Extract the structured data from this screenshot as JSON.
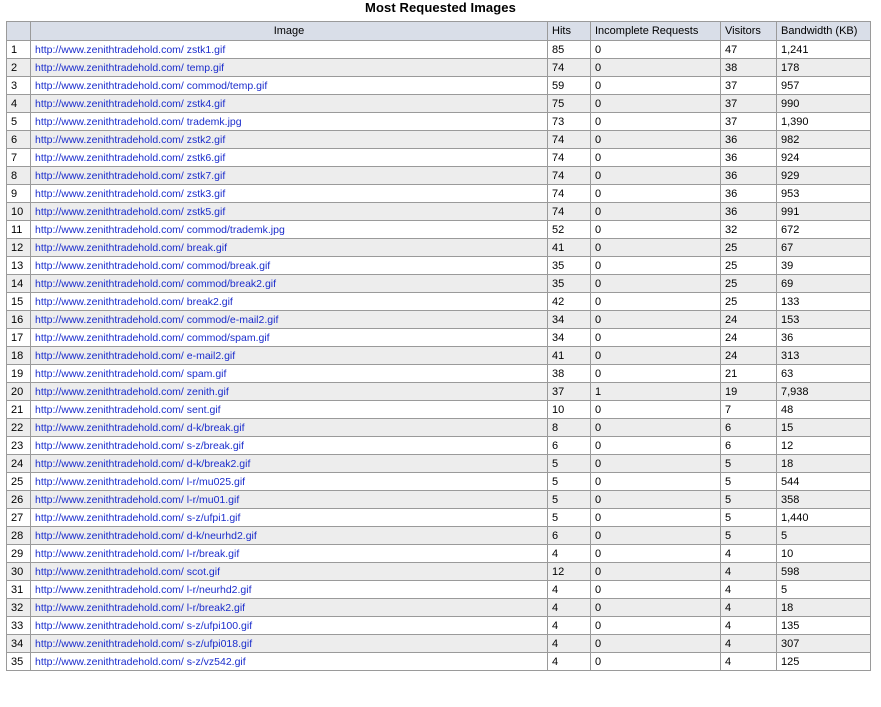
{
  "title": "Most Requested Images",
  "columns": {
    "num": "",
    "image": "Image",
    "hits": "Hits",
    "incomplete": "Incomplete Requests",
    "visitors": "Visitors",
    "bandwidth": "Bandwidth (KB)"
  },
  "rows": [
    {
      "n": "1",
      "url": "http://www.zenithtradehold.com/ zstk1.gif",
      "hits": "85",
      "incomplete": "0",
      "visitors": "47",
      "bandwidth": "1,241"
    },
    {
      "n": "2",
      "url": "http://www.zenithtradehold.com/ temp.gif",
      "hits": "74",
      "incomplete": "0",
      "visitors": "38",
      "bandwidth": "178"
    },
    {
      "n": "3",
      "url": "http://www.zenithtradehold.com/ commod/temp.gif",
      "hits": "59",
      "incomplete": "0",
      "visitors": "37",
      "bandwidth": "957"
    },
    {
      "n": "4",
      "url": "http://www.zenithtradehold.com/ zstk4.gif",
      "hits": "75",
      "incomplete": "0",
      "visitors": "37",
      "bandwidth": "990"
    },
    {
      "n": "5",
      "url": "http://www.zenithtradehold.com/ trademk.jpg",
      "hits": "73",
      "incomplete": "0",
      "visitors": "37",
      "bandwidth": "1,390"
    },
    {
      "n": "6",
      "url": "http://www.zenithtradehold.com/ zstk2.gif",
      "hits": "74",
      "incomplete": "0",
      "visitors": "36",
      "bandwidth": "982"
    },
    {
      "n": "7",
      "url": "http://www.zenithtradehold.com/ zstk6.gif",
      "hits": "74",
      "incomplete": "0",
      "visitors": "36",
      "bandwidth": "924"
    },
    {
      "n": "8",
      "url": "http://www.zenithtradehold.com/ zstk7.gif",
      "hits": "74",
      "incomplete": "0",
      "visitors": "36",
      "bandwidth": "929"
    },
    {
      "n": "9",
      "url": "http://www.zenithtradehold.com/ zstk3.gif",
      "hits": "74",
      "incomplete": "0",
      "visitors": "36",
      "bandwidth": "953"
    },
    {
      "n": "10",
      "url": "http://www.zenithtradehold.com/ zstk5.gif",
      "hits": "74",
      "incomplete": "0",
      "visitors": "36",
      "bandwidth": "991"
    },
    {
      "n": "11",
      "url": "http://www.zenithtradehold.com/ commod/trademk.jpg",
      "hits": "52",
      "incomplete": "0",
      "visitors": "32",
      "bandwidth": "672"
    },
    {
      "n": "12",
      "url": "http://www.zenithtradehold.com/ break.gif",
      "hits": "41",
      "incomplete": "0",
      "visitors": "25",
      "bandwidth": "67"
    },
    {
      "n": "13",
      "url": "http://www.zenithtradehold.com/ commod/break.gif",
      "hits": "35",
      "incomplete": "0",
      "visitors": "25",
      "bandwidth": "39"
    },
    {
      "n": "14",
      "url": "http://www.zenithtradehold.com/ commod/break2.gif",
      "hits": "35",
      "incomplete": "0",
      "visitors": "25",
      "bandwidth": "69"
    },
    {
      "n": "15",
      "url": "http://www.zenithtradehold.com/ break2.gif",
      "hits": "42",
      "incomplete": "0",
      "visitors": "25",
      "bandwidth": "133"
    },
    {
      "n": "16",
      "url": "http://www.zenithtradehold.com/ commod/e-mail2.gif",
      "hits": "34",
      "incomplete": "0",
      "visitors": "24",
      "bandwidth": "153"
    },
    {
      "n": "17",
      "url": "http://www.zenithtradehold.com/ commod/spam.gif",
      "hits": "34",
      "incomplete": "0",
      "visitors": "24",
      "bandwidth": "36"
    },
    {
      "n": "18",
      "url": "http://www.zenithtradehold.com/ e-mail2.gif",
      "hits": "41",
      "incomplete": "0",
      "visitors": "24",
      "bandwidth": "313"
    },
    {
      "n": "19",
      "url": "http://www.zenithtradehold.com/ spam.gif",
      "hits": "38",
      "incomplete": "0",
      "visitors": "21",
      "bandwidth": "63"
    },
    {
      "n": "20",
      "url": "http://www.zenithtradehold.com/ zenith.gif",
      "hits": "37",
      "incomplete": "1",
      "visitors": "19",
      "bandwidth": "7,938"
    },
    {
      "n": "21",
      "url": "http://www.zenithtradehold.com/ sent.gif",
      "hits": "10",
      "incomplete": "0",
      "visitors": "7",
      "bandwidth": "48"
    },
    {
      "n": "22",
      "url": "http://www.zenithtradehold.com/ d-k/break.gif",
      "hits": "8",
      "incomplete": "0",
      "visitors": "6",
      "bandwidth": "15"
    },
    {
      "n": "23",
      "url": "http://www.zenithtradehold.com/ s-z/break.gif",
      "hits": "6",
      "incomplete": "0",
      "visitors": "6",
      "bandwidth": "12"
    },
    {
      "n": "24",
      "url": "http://www.zenithtradehold.com/ d-k/break2.gif",
      "hits": "5",
      "incomplete": "0",
      "visitors": "5",
      "bandwidth": "18"
    },
    {
      "n": "25",
      "url": "http://www.zenithtradehold.com/ l-r/mu025.gif",
      "hits": "5",
      "incomplete": "0",
      "visitors": "5",
      "bandwidth": "544"
    },
    {
      "n": "26",
      "url": "http://www.zenithtradehold.com/ l-r/mu01.gif",
      "hits": "5",
      "incomplete": "0",
      "visitors": "5",
      "bandwidth": "358"
    },
    {
      "n": "27",
      "url": "http://www.zenithtradehold.com/ s-z/ufpi1.gif",
      "hits": "5",
      "incomplete": "0",
      "visitors": "5",
      "bandwidth": "1,440"
    },
    {
      "n": "28",
      "url": "http://www.zenithtradehold.com/ d-k/neurhd2.gif",
      "hits": "6",
      "incomplete": "0",
      "visitors": "5",
      "bandwidth": "5"
    },
    {
      "n": "29",
      "url": "http://www.zenithtradehold.com/ l-r/break.gif",
      "hits": "4",
      "incomplete": "0",
      "visitors": "4",
      "bandwidth": "10"
    },
    {
      "n": "30",
      "url": "http://www.zenithtradehold.com/ scot.gif",
      "hits": "12",
      "incomplete": "0",
      "visitors": "4",
      "bandwidth": "598"
    },
    {
      "n": "31",
      "url": "http://www.zenithtradehold.com/ l-r/neurhd2.gif",
      "hits": "4",
      "incomplete": "0",
      "visitors": "4",
      "bandwidth": "5"
    },
    {
      "n": "32",
      "url": "http://www.zenithtradehold.com/ l-r/break2.gif",
      "hits": "4",
      "incomplete": "0",
      "visitors": "4",
      "bandwidth": "18"
    },
    {
      "n": "33",
      "url": "http://www.zenithtradehold.com/ s-z/ufpi100.gif",
      "hits": "4",
      "incomplete": "0",
      "visitors": "4",
      "bandwidth": "135"
    },
    {
      "n": "34",
      "url": "http://www.zenithtradehold.com/ s-z/ufpi018.gif",
      "hits": "4",
      "incomplete": "0",
      "visitors": "4",
      "bandwidth": "307"
    },
    {
      "n": "35",
      "url": "http://www.zenithtradehold.com/ s-z/vz542.gif",
      "hits": "4",
      "incomplete": "0",
      "visitors": "4",
      "bandwidth": "125"
    }
  ],
  "colors": {
    "link": "#1a2ccc",
    "header_bg": "#d9dee8",
    "row_alt_bg": "#ededed",
    "border": "#9a9a9a"
  }
}
